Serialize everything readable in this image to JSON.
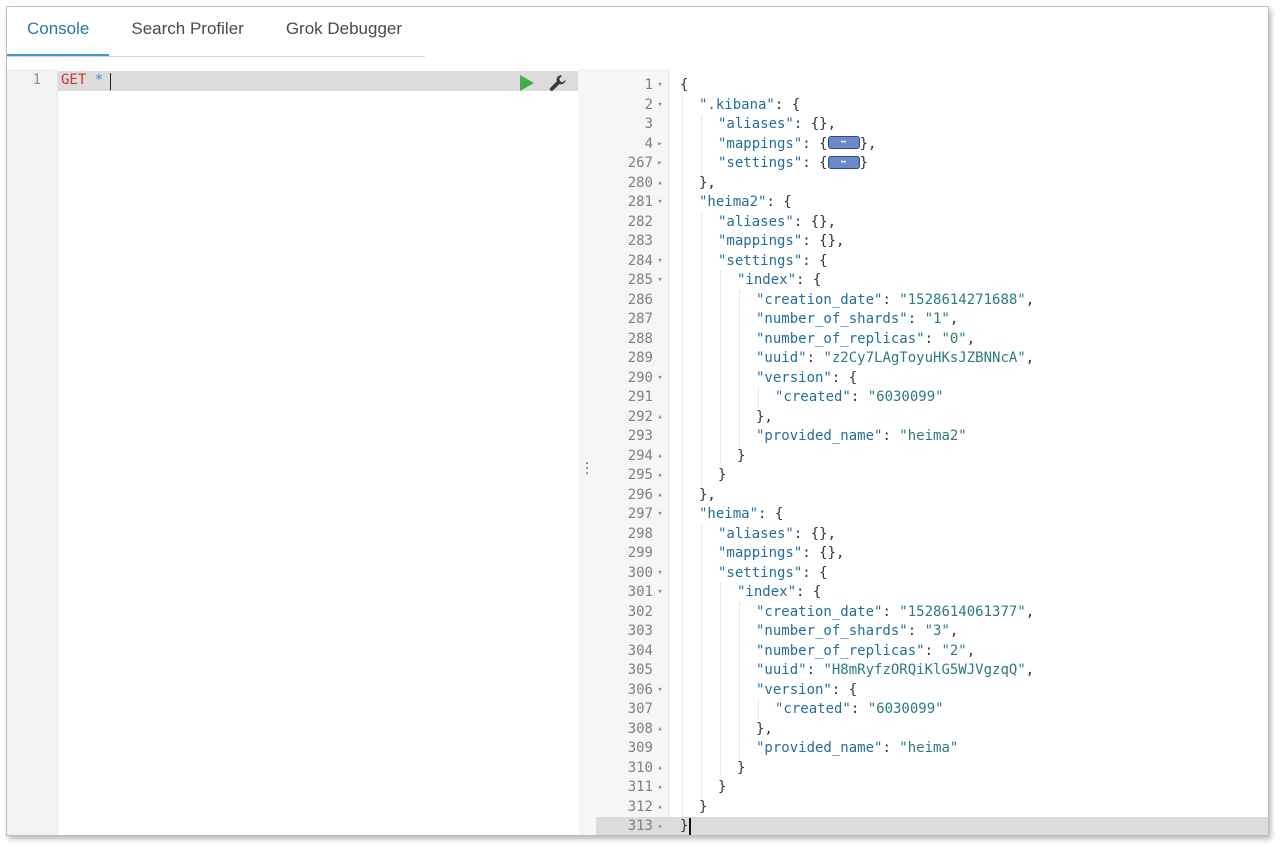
{
  "tabs": [
    {
      "label": "Console",
      "active": true
    },
    {
      "label": "Search Profiler",
      "active": false
    },
    {
      "label": "Grok Debugger",
      "active": false
    }
  ],
  "request": {
    "line_number": "1",
    "method": "GET",
    "path": "*"
  },
  "icons": {
    "run": "play-icon",
    "settings": "wrench-icon",
    "resize": "vertical-dots-icon",
    "collapsed": "collapsed-block-icon"
  },
  "colors": {
    "active_tab": "#2678a8",
    "run_button": "#43ad49",
    "method": "#c9342b",
    "key": "#236e9a",
    "string": "#2b7c78"
  },
  "response": {
    "lines": [
      {
        "n": "1",
        "fold": "open",
        "indent": 0,
        "parts": [
          {
            "t": "{",
            "c": "p"
          }
        ]
      },
      {
        "n": "2",
        "fold": "open",
        "indent": 1,
        "parts": [
          {
            "t": "\".kibana\"",
            "c": "k"
          },
          {
            "t": ": {",
            "c": "p"
          }
        ]
      },
      {
        "n": "3",
        "fold": "",
        "indent": 2,
        "parts": [
          {
            "t": "\"aliases\"",
            "c": "k"
          },
          {
            "t": ": {},",
            "c": "p"
          }
        ]
      },
      {
        "n": "4",
        "fold": "closed",
        "indent": 2,
        "parts": [
          {
            "t": "\"mappings\"",
            "c": "k"
          },
          {
            "t": ": {",
            "c": "p"
          },
          {
            "t": "",
            "c": "box"
          },
          {
            "t": "},",
            "c": "p"
          }
        ]
      },
      {
        "n": "267",
        "fold": "closed",
        "indent": 2,
        "parts": [
          {
            "t": "\"settings\"",
            "c": "k"
          },
          {
            "t": ": {",
            "c": "p"
          },
          {
            "t": "",
            "c": "box"
          },
          {
            "t": "}",
            "c": "p"
          }
        ]
      },
      {
        "n": "280",
        "fold": "end",
        "indent": 1,
        "parts": [
          {
            "t": "},",
            "c": "p"
          }
        ]
      },
      {
        "n": "281",
        "fold": "open",
        "indent": 1,
        "parts": [
          {
            "t": "\"heima2\"",
            "c": "k"
          },
          {
            "t": ": {",
            "c": "p"
          }
        ]
      },
      {
        "n": "282",
        "fold": "",
        "indent": 2,
        "parts": [
          {
            "t": "\"aliases\"",
            "c": "k"
          },
          {
            "t": ": {},",
            "c": "p"
          }
        ]
      },
      {
        "n": "283",
        "fold": "",
        "indent": 2,
        "parts": [
          {
            "t": "\"mappings\"",
            "c": "k"
          },
          {
            "t": ": {},",
            "c": "p"
          }
        ]
      },
      {
        "n": "284",
        "fold": "open",
        "indent": 2,
        "parts": [
          {
            "t": "\"settings\"",
            "c": "k"
          },
          {
            "t": ": {",
            "c": "p"
          }
        ]
      },
      {
        "n": "285",
        "fold": "open",
        "indent": 3,
        "parts": [
          {
            "t": "\"index\"",
            "c": "k"
          },
          {
            "t": ": {",
            "c": "p"
          }
        ]
      },
      {
        "n": "286",
        "fold": "",
        "indent": 4,
        "parts": [
          {
            "t": "\"creation_date\"",
            "c": "k"
          },
          {
            "t": ": ",
            "c": "p"
          },
          {
            "t": "\"1528614271688\"",
            "c": "s"
          },
          {
            "t": ",",
            "c": "p"
          }
        ]
      },
      {
        "n": "287",
        "fold": "",
        "indent": 4,
        "parts": [
          {
            "t": "\"number_of_shards\"",
            "c": "k"
          },
          {
            "t": ": ",
            "c": "p"
          },
          {
            "t": "\"1\"",
            "c": "s"
          },
          {
            "t": ",",
            "c": "p"
          }
        ]
      },
      {
        "n": "288",
        "fold": "",
        "indent": 4,
        "parts": [
          {
            "t": "\"number_of_replicas\"",
            "c": "k"
          },
          {
            "t": ": ",
            "c": "p"
          },
          {
            "t": "\"0\"",
            "c": "s"
          },
          {
            "t": ",",
            "c": "p"
          }
        ]
      },
      {
        "n": "289",
        "fold": "",
        "indent": 4,
        "parts": [
          {
            "t": "\"uuid\"",
            "c": "k"
          },
          {
            "t": ": ",
            "c": "p"
          },
          {
            "t": "\"z2Cy7LAgToyuHKsJZBNNcA\"",
            "c": "s"
          },
          {
            "t": ",",
            "c": "p"
          }
        ]
      },
      {
        "n": "290",
        "fold": "open",
        "indent": 4,
        "parts": [
          {
            "t": "\"version\"",
            "c": "k"
          },
          {
            "t": ": {",
            "c": "p"
          }
        ]
      },
      {
        "n": "291",
        "fold": "",
        "indent": 5,
        "parts": [
          {
            "t": "\"created\"",
            "c": "k"
          },
          {
            "t": ": ",
            "c": "p"
          },
          {
            "t": "\"6030099\"",
            "c": "s"
          }
        ]
      },
      {
        "n": "292",
        "fold": "end",
        "indent": 4,
        "parts": [
          {
            "t": "},",
            "c": "p"
          }
        ]
      },
      {
        "n": "293",
        "fold": "",
        "indent": 4,
        "parts": [
          {
            "t": "\"provided_name\"",
            "c": "k"
          },
          {
            "t": ": ",
            "c": "p"
          },
          {
            "t": "\"heima2\"",
            "c": "s"
          }
        ]
      },
      {
        "n": "294",
        "fold": "end",
        "indent": 3,
        "parts": [
          {
            "t": "}",
            "c": "p"
          }
        ]
      },
      {
        "n": "295",
        "fold": "end",
        "indent": 2,
        "parts": [
          {
            "t": "}",
            "c": "p"
          }
        ]
      },
      {
        "n": "296",
        "fold": "end",
        "indent": 1,
        "parts": [
          {
            "t": "},",
            "c": "p"
          }
        ]
      },
      {
        "n": "297",
        "fold": "open",
        "indent": 1,
        "parts": [
          {
            "t": "\"heima\"",
            "c": "k"
          },
          {
            "t": ": {",
            "c": "p"
          }
        ]
      },
      {
        "n": "298",
        "fold": "",
        "indent": 2,
        "parts": [
          {
            "t": "\"aliases\"",
            "c": "k"
          },
          {
            "t": ": {},",
            "c": "p"
          }
        ]
      },
      {
        "n": "299",
        "fold": "",
        "indent": 2,
        "parts": [
          {
            "t": "\"mappings\"",
            "c": "k"
          },
          {
            "t": ": {},",
            "c": "p"
          }
        ]
      },
      {
        "n": "300",
        "fold": "open",
        "indent": 2,
        "parts": [
          {
            "t": "\"settings\"",
            "c": "k"
          },
          {
            "t": ": {",
            "c": "p"
          }
        ]
      },
      {
        "n": "301",
        "fold": "open",
        "indent": 3,
        "parts": [
          {
            "t": "\"index\"",
            "c": "k"
          },
          {
            "t": ": {",
            "c": "p"
          }
        ]
      },
      {
        "n": "302",
        "fold": "",
        "indent": 4,
        "parts": [
          {
            "t": "\"creation_date\"",
            "c": "k"
          },
          {
            "t": ": ",
            "c": "p"
          },
          {
            "t": "\"1528614061377\"",
            "c": "s"
          },
          {
            "t": ",",
            "c": "p"
          }
        ]
      },
      {
        "n": "303",
        "fold": "",
        "indent": 4,
        "parts": [
          {
            "t": "\"number_of_shards\"",
            "c": "k"
          },
          {
            "t": ": ",
            "c": "p"
          },
          {
            "t": "\"3\"",
            "c": "s"
          },
          {
            "t": ",",
            "c": "p"
          }
        ]
      },
      {
        "n": "304",
        "fold": "",
        "indent": 4,
        "parts": [
          {
            "t": "\"number_of_replicas\"",
            "c": "k"
          },
          {
            "t": ": ",
            "c": "p"
          },
          {
            "t": "\"2\"",
            "c": "s"
          },
          {
            "t": ",",
            "c": "p"
          }
        ]
      },
      {
        "n": "305",
        "fold": "",
        "indent": 4,
        "parts": [
          {
            "t": "\"uuid\"",
            "c": "k"
          },
          {
            "t": ": ",
            "c": "p"
          },
          {
            "t": "\"H8mRyfzORQiKlG5WJVgzqQ\"",
            "c": "s"
          },
          {
            "t": ",",
            "c": "p"
          }
        ]
      },
      {
        "n": "306",
        "fold": "open",
        "indent": 4,
        "parts": [
          {
            "t": "\"version\"",
            "c": "k"
          },
          {
            "t": ": {",
            "c": "p"
          }
        ]
      },
      {
        "n": "307",
        "fold": "",
        "indent": 5,
        "parts": [
          {
            "t": "\"created\"",
            "c": "k"
          },
          {
            "t": ": ",
            "c": "p"
          },
          {
            "t": "\"6030099\"",
            "c": "s"
          }
        ]
      },
      {
        "n": "308",
        "fold": "end",
        "indent": 4,
        "parts": [
          {
            "t": "},",
            "c": "p"
          }
        ]
      },
      {
        "n": "309",
        "fold": "",
        "indent": 4,
        "parts": [
          {
            "t": "\"provided_name\"",
            "c": "k"
          },
          {
            "t": ": ",
            "c": "p"
          },
          {
            "t": "\"heima\"",
            "c": "s"
          }
        ]
      },
      {
        "n": "310",
        "fold": "end",
        "indent": 3,
        "parts": [
          {
            "t": "}",
            "c": "p"
          }
        ]
      },
      {
        "n": "311",
        "fold": "end",
        "indent": 2,
        "parts": [
          {
            "t": "}",
            "c": "p"
          }
        ]
      },
      {
        "n": "312",
        "fold": "end",
        "indent": 1,
        "parts": [
          {
            "t": "}",
            "c": "p"
          }
        ]
      },
      {
        "n": "313",
        "fold": "end",
        "indent": 0,
        "parts": [
          {
            "t": "}",
            "c": "p"
          }
        ],
        "current": true
      }
    ]
  }
}
